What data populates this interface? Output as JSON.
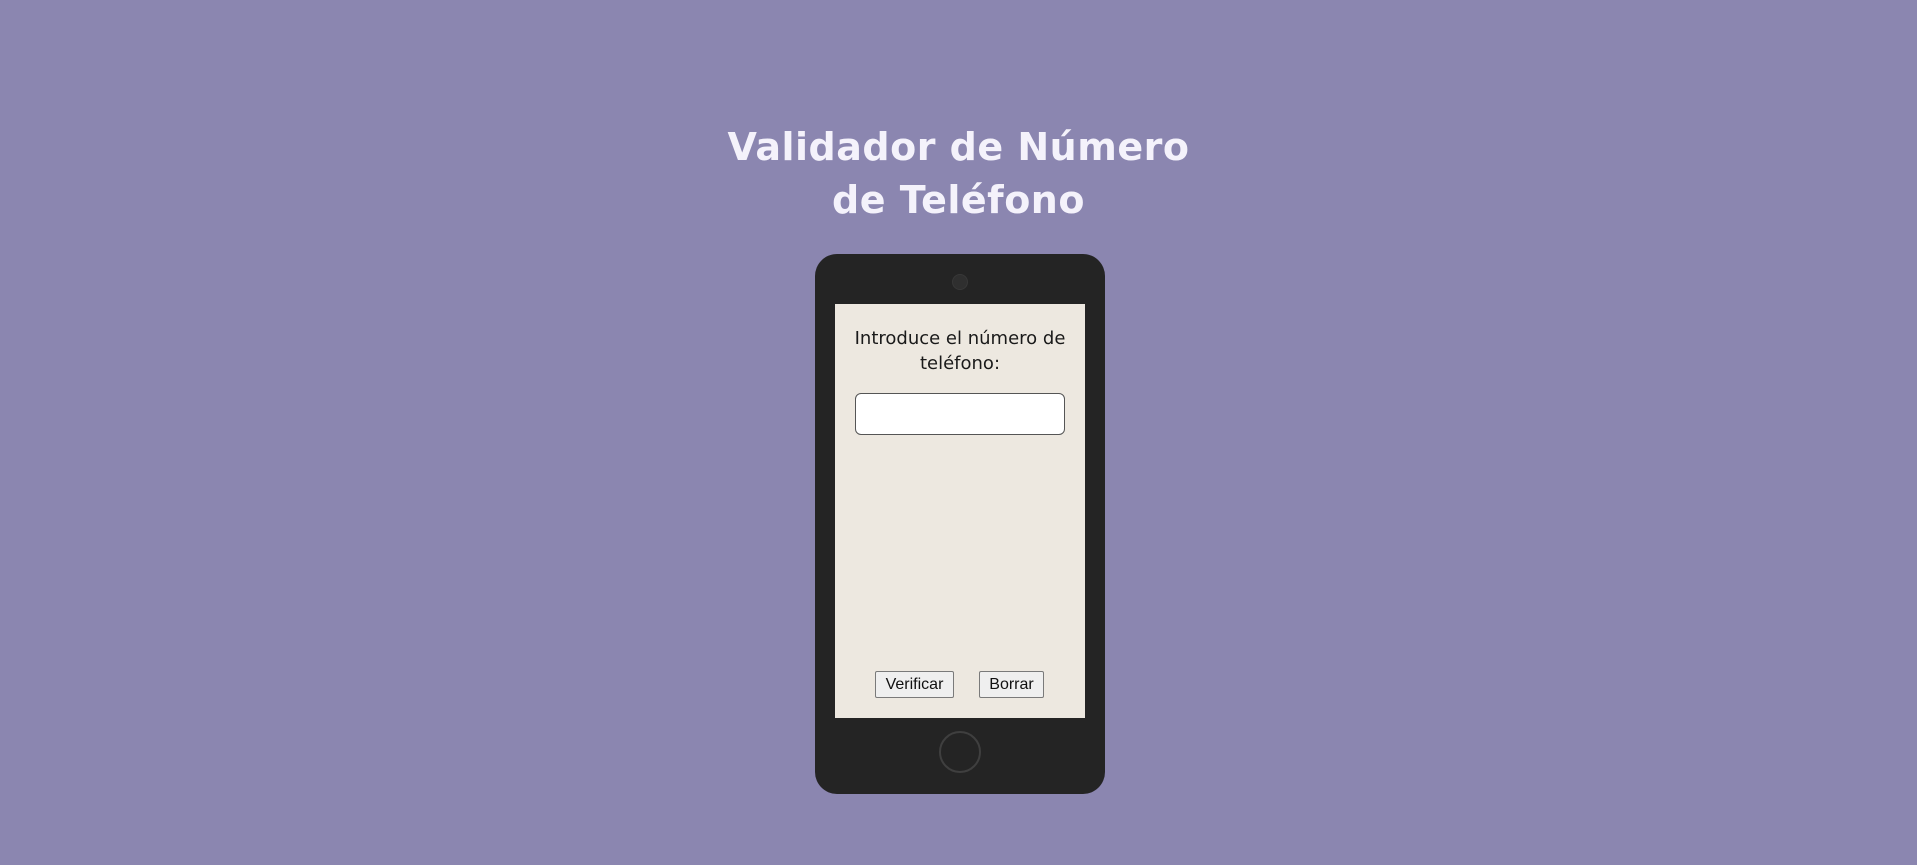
{
  "page": {
    "title_line1": "Validador de Número",
    "title_line2": "de Teléfono"
  },
  "screen": {
    "prompt": "Introduce el número de teléfono:",
    "input_value": "",
    "buttons": {
      "verify_label": "Verificar",
      "clear_label": "Borrar"
    }
  },
  "colors": {
    "background": "#8b86b0",
    "phone_body": "#242424",
    "screen_background": "#ede8e0",
    "title_text": "#f4f2fb"
  },
  "icons": {
    "camera": "camera-icon",
    "home": "home-button-icon"
  }
}
